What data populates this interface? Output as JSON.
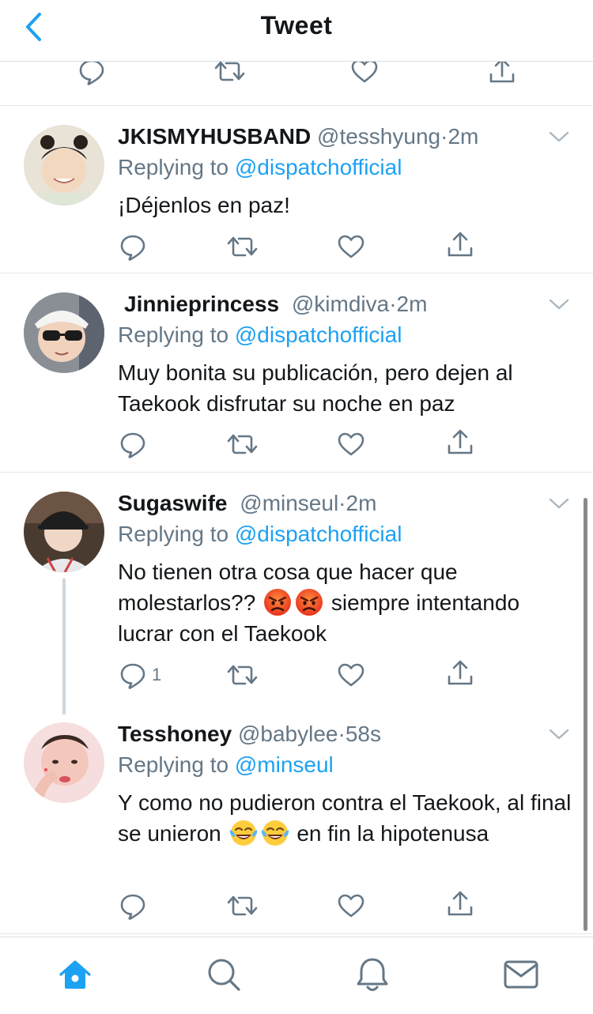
{
  "header": {
    "title": "Tweet"
  },
  "colors": {
    "accent": "#1da1f2",
    "secondary_text": "#657786",
    "primary_text": "#14171a"
  },
  "tweets": [
    {
      "name": "JKISMYHUSBAND",
      "handle": "@tesshyung",
      "sep": "·",
      "time": "2m",
      "replying_prefix": "Replying to",
      "replying_to": "@dispatchofficial",
      "text": "¡Déjenlos en paz!"
    },
    {
      "name": "Jinnieprincess",
      "handle": "@kimdiva",
      "sep": "·",
      "time": "2m",
      "replying_prefix": "Replying to",
      "replying_to": "@dispatchofficial",
      "text": "Muy bonita su publicación, pero dejen al Taekook disfrutar su noche en paz"
    },
    {
      "name": "Sugaswife",
      "handle": "@minseul",
      "sep": "·",
      "time": "2m",
      "replying_prefix": "Replying to",
      "replying_to": "@dispatchofficial",
      "text_before": "No tienen otra cosa que hacer que molestarlos?? ",
      "emoji": "angry-face",
      "text_after": " siempre intentando lucrar con el Taekook",
      "reply_count": "1"
    },
    {
      "name": "Tesshoney",
      "handle": "@babylee",
      "sep": "·",
      "time": "58s",
      "replying_prefix": "Replying to",
      "replying_to": "@minseul",
      "text_before": "Y como no pudieron contra el Taekook, al final se unieron ",
      "emoji": "tears-of-joy-face",
      "text_after": " en fin la hipotenusa"
    }
  ],
  "tabbar": {
    "items": [
      "home-icon",
      "search-icon",
      "notifications-icon",
      "messages-icon"
    ],
    "active": "home-icon"
  }
}
